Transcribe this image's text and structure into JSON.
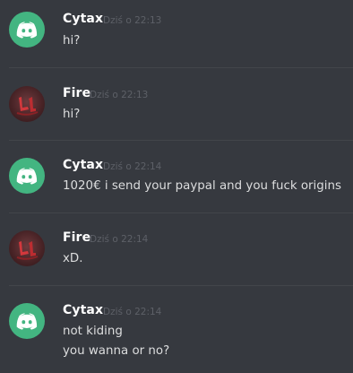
{
  "messages": [
    {
      "author": "Cytax",
      "avatar_icon": "discord-logo-icon",
      "timestamp": "Dziś o 22:13",
      "lines": [
        "hi?"
      ]
    },
    {
      "author": "Fire",
      "avatar_icon": "red-graffiti-avatar-icon",
      "timestamp": "Dziś o 22:13",
      "lines": [
        "hi?"
      ]
    },
    {
      "author": "Cytax",
      "avatar_icon": "discord-logo-icon",
      "timestamp": "Dziś o 22:14",
      "lines": [
        "1020€ i send your paypal and you fuck origins"
      ]
    },
    {
      "author": "Fire",
      "avatar_icon": "red-graffiti-avatar-icon",
      "timestamp": "Dziś o 22:14",
      "lines": [
        "xD."
      ]
    },
    {
      "author": "Cytax",
      "avatar_icon": "discord-logo-icon",
      "timestamp": "Dziś o 22:14",
      "lines": [
        "not kiding",
        "you wanna or no?"
      ]
    }
  ],
  "colors": {
    "background": "#36393f",
    "divider": "#42454a",
    "discord_avatar": "#43b581",
    "username": "#ffffff",
    "timestamp": "#5d6067",
    "message_text": "#dcddde"
  }
}
